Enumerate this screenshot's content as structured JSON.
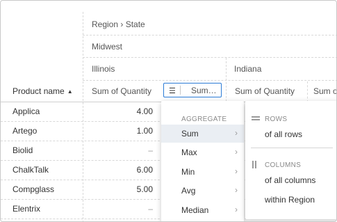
{
  "pivot": {
    "row_header_label": "Product name",
    "sort_indicator": "▲",
    "column_path": "Region › State",
    "region": "Midwest",
    "states": [
      "Illinois",
      "Indiana"
    ],
    "measure_headers": [
      "Sum of Quantity",
      "Sum…",
      "Sum of Quantity",
      "Sum o"
    ],
    "rows": [
      {
        "name": "Applica",
        "illinois_qty": "4.00"
      },
      {
        "name": "Artego",
        "illinois_qty": "1.00"
      },
      {
        "name": "Biolid",
        "illinois_qty": "–"
      },
      {
        "name": "ChalkTalk",
        "illinois_qty": "6.00"
      },
      {
        "name": "Compglass",
        "illinois_qty": "5.00"
      },
      {
        "name": "Elentrix",
        "illinois_qty": "–"
      }
    ]
  },
  "measure_button": {
    "icon": "hamburger-icon",
    "glyph": "☰"
  },
  "aggregate_menu": {
    "caption": "AGGREGATE",
    "chevron": "›",
    "items": [
      "Sum",
      "Max",
      "Min",
      "Avg",
      "Median"
    ],
    "active_index": 0
  },
  "percent_menu": {
    "rows_caption": "ROWS",
    "rows_options": [
      "of all rows"
    ],
    "columns_caption": "COLUMNS",
    "columns_options": [
      "of all columns",
      "within Region"
    ]
  },
  "colors": {
    "accent": "#2b7bd6",
    "active_item_bg": "#eaeef3",
    "grid_line": "#d8d8d8"
  }
}
